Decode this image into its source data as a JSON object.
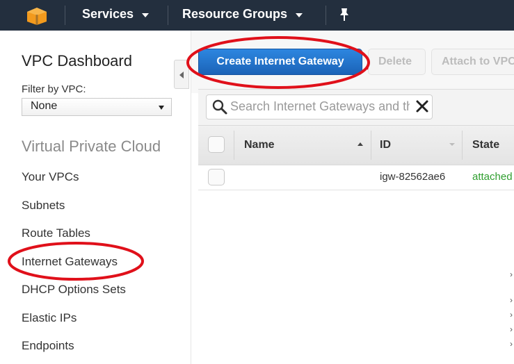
{
  "topbar": {
    "services_label": "Services",
    "resource_groups_label": "Resource Groups"
  },
  "sidebar": {
    "title": "VPC Dashboard",
    "filter_label": "Filter by VPC:",
    "filter_value": "None",
    "section_title": "Virtual Private Cloud",
    "items": [
      {
        "label": "Your VPCs"
      },
      {
        "label": "Subnets"
      },
      {
        "label": "Route Tables"
      },
      {
        "label": "Internet Gateways"
      },
      {
        "label": "DHCP Options Sets"
      },
      {
        "label": "Elastic IPs"
      },
      {
        "label": "Endpoints"
      }
    ]
  },
  "toolbar": {
    "create_label": "Create Internet Gateway",
    "delete_label": "Delete",
    "attach_label": "Attach to VPC"
  },
  "search": {
    "placeholder": "Search Internet Gateways and their properties"
  },
  "table": {
    "columns": [
      "Name",
      "ID",
      "State"
    ],
    "rows": [
      {
        "name": "",
        "id": "igw-82562ae6",
        "state": "attached"
      }
    ]
  },
  "colors": {
    "topbar": "#232f3e",
    "primary_button": "#1b63b7",
    "state_attached": "#2e9e2e",
    "annotation_red": "#e0101a"
  }
}
